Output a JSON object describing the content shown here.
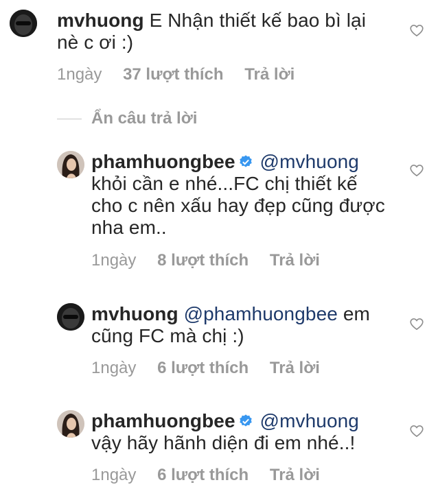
{
  "comments": [
    {
      "username": "mvhuong",
      "avatar": "masked-avatar",
      "verified": false,
      "text_line1": "E Nhận thiết kế bao bì lại",
      "text_line2": "nè c ơi :)",
      "time": "1ngày",
      "likes": "37 lượt thích",
      "reply": "Trả lời"
    },
    {
      "username": "phamhuongbee",
      "avatar": "woman-avatar",
      "verified": true,
      "mention": "@mvhuong",
      "text_line1": "khỏi cần e nhé...FC chị thiết kế",
      "text_line2": "cho c nên xấu hay đẹp cũng được",
      "text_line3": "nha em..",
      "time": "1ngày",
      "likes": "8 lượt thích",
      "reply": "Trả lời"
    },
    {
      "username": "mvhuong",
      "avatar": "masked-avatar",
      "verified": false,
      "mention": "@phamhuongbee",
      "text_line1_tail": "em",
      "text_line2": "cũng FC mà chị :)",
      "time": "1ngày",
      "likes": "6 lượt thích",
      "reply": "Trả lời"
    },
    {
      "username": "phamhuongbee",
      "avatar": "woman-avatar",
      "verified": true,
      "mention": "@mvhuong",
      "text_line2": "vậy hãy hãnh diện đi em nhé..!",
      "time": "1ngày",
      "likes": "6 lượt thích",
      "reply": "Trả lời"
    }
  ],
  "hide_replies_label": "Ẩn câu trả lời",
  "icons": {
    "like": "heart-outline-icon",
    "verified": "verified-badge-icon"
  },
  "colors": {
    "mention": "#1e3a6b",
    "meta": "#999999",
    "verified": "#3897f0"
  }
}
